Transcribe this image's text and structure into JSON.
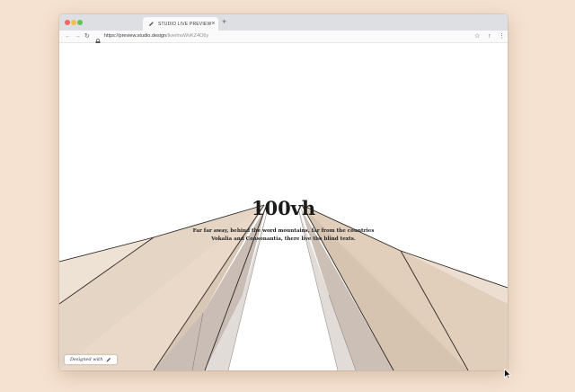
{
  "browser": {
    "tab_title": "STUDIO LIVE PREVIEW",
    "tab_close": "×",
    "new_tab": "+",
    "url_host": "https://preview.studio.design",
    "url_path": "/live/moWvKZ4O6y",
    "nav": {
      "back": "←",
      "forward": "→",
      "reload": "↻"
    },
    "icons": {
      "bookmark": "☆",
      "extension": "↑",
      "menu": "⋮"
    }
  },
  "hero": {
    "title": "100vh",
    "text_line1": "Far far away, behind the word mountains, far from the countries",
    "text_line2": "Vokalia and Consonantia, there live the blind texts."
  },
  "badge": {
    "label": "Designed with"
  },
  "colors": {
    "page_background": "#f6e2d1",
    "panel_light": "#eee2d4",
    "panel_mid": "#e3d2c0",
    "panel_dark": "#d8c5b1",
    "sky": "#ffffff",
    "traffic_close": "#ee6a5e",
    "traffic_min": "#f5be4f",
    "traffic_max": "#62c554"
  }
}
